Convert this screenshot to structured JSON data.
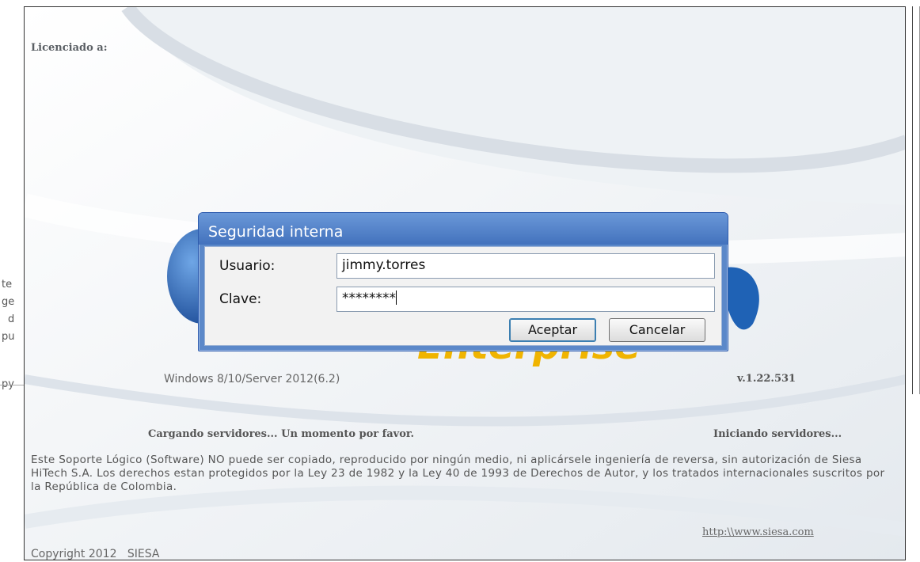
{
  "background": {
    "fragments": [
      "te",
      "ge",
      "d",
      "pu",
      "py"
    ]
  },
  "splash": {
    "licensed_label": "Licenciado a:",
    "brand_word": "Enterprise",
    "os_text": "Windows 8/10/Server 2012(6.2)",
    "version": "v.1.22.531",
    "loading_text": "Cargando servidores... Un momento por favor.",
    "starting_text": "Iniciando servidores...",
    "legal_text": "Este Soporte Lógico (Software) NO puede ser copiado, reproducido por ningún medio, ni aplicársele ingeniería de reversa, sin autorización de Siesa HiTech S.A. Los derechos estan protegidos por la Ley 23 de 1982 y la Ley 40 de 1993 de Derechos de Autor, y los tratados internacionales suscritos por la República de Colombia.",
    "link": "http:\\\\www.siesa.com",
    "copyright": "Copyright 2012   SIESA",
    "colors": {
      "brand_yellow": "#f0b400",
      "logo_blue": "#1f62b5",
      "title_blue": "#4f7fc6"
    }
  },
  "dialog": {
    "title": "Seguridad interna",
    "user_label": "Usuario:",
    "user_value": "jimmy.torres",
    "password_label": "Clave:",
    "password_value": "********",
    "accept_label": "Aceptar",
    "cancel_label": "Cancelar"
  }
}
